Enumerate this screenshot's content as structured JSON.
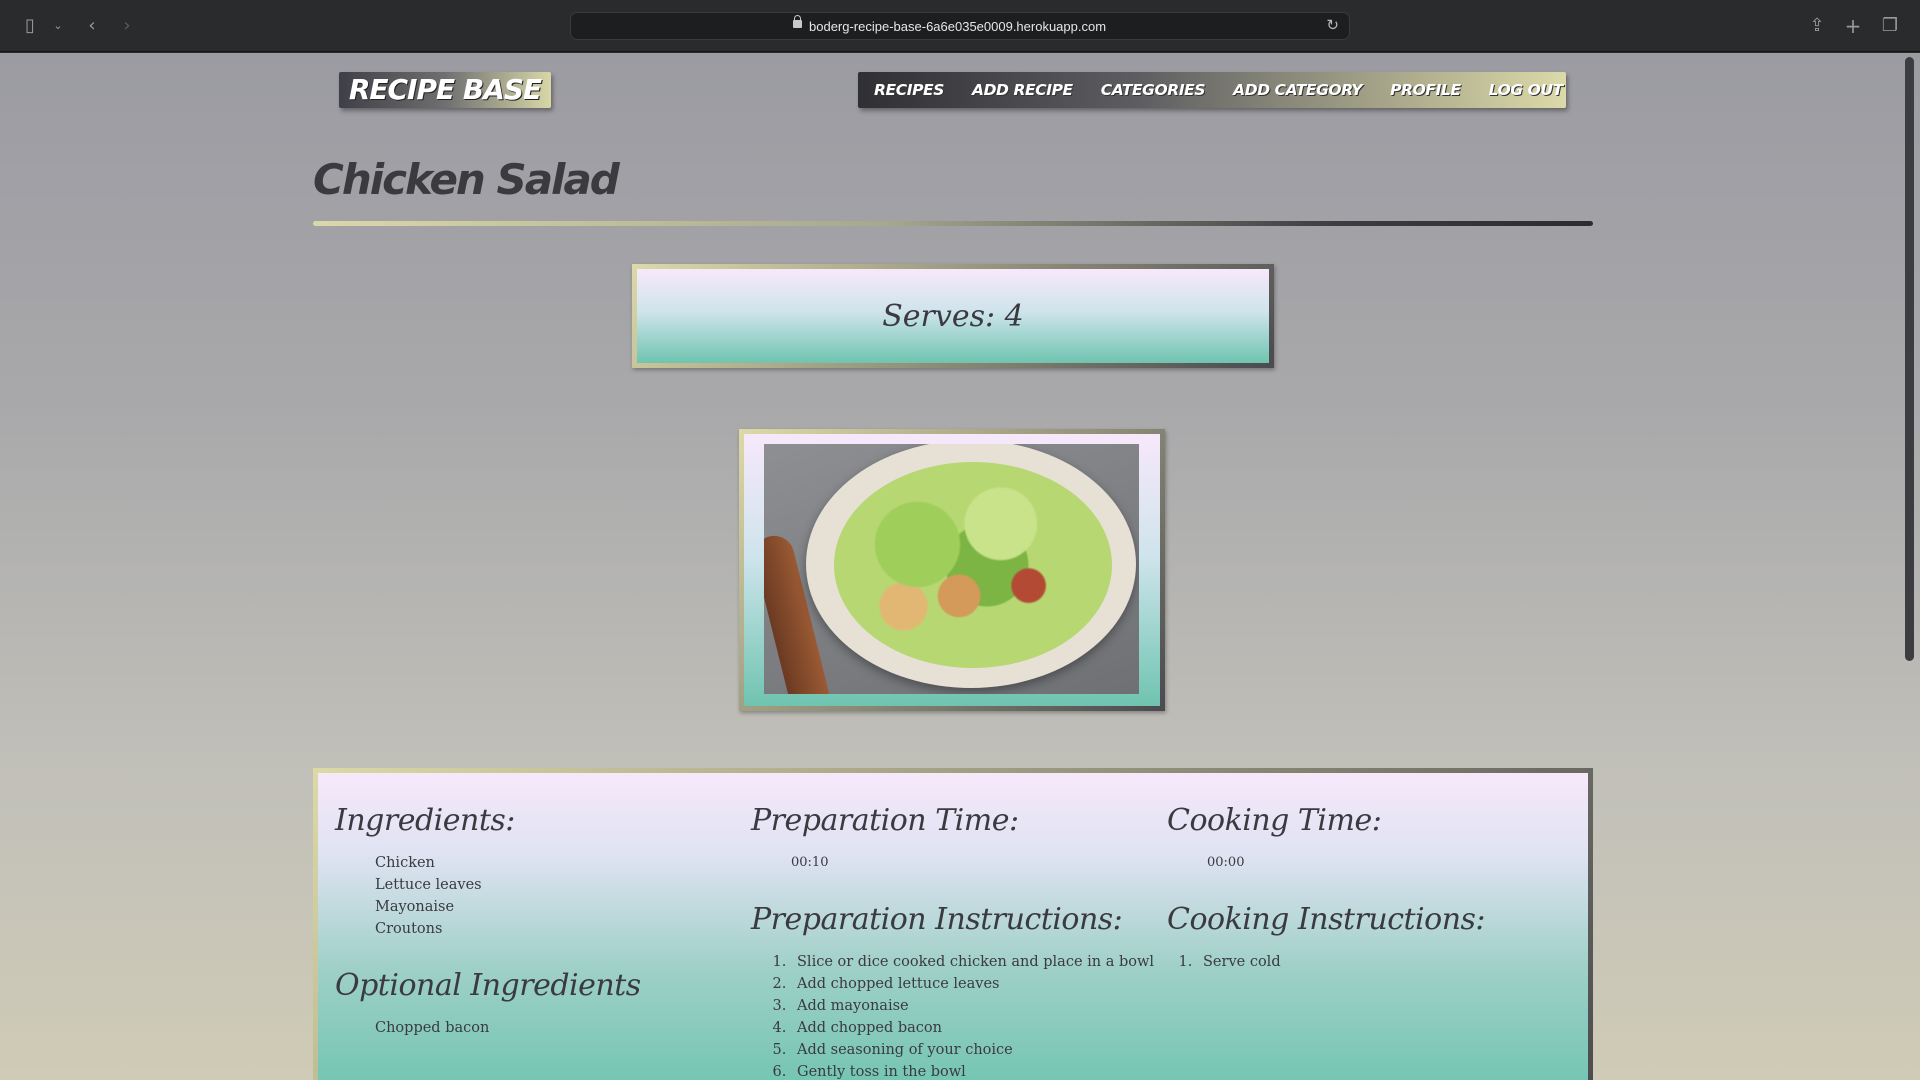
{
  "browser": {
    "url": "boderg-recipe-base-6a6e035e0009.herokuapp.com",
    "icons": {
      "sidebar": "sidebar-icon",
      "back": "back-arrow-icon",
      "forward": "forward-arrow-icon",
      "share": "share-icon",
      "new_tab": "plus-icon",
      "tabs": "tabs-overview-icon",
      "reload": "reload-icon",
      "lock": "lock-icon"
    }
  },
  "header": {
    "logo": "RECIPE BASE",
    "nav": [
      "RECIPES",
      "ADD RECIPE",
      "CATEGORIES",
      "ADD CATEGORY",
      "PROFILE",
      "LOG OUT"
    ]
  },
  "recipe": {
    "title": "Chicken Salad",
    "serves": "Serves: 4",
    "ingredients_heading": "Ingredients:",
    "ingredients": [
      "Chicken",
      "Lettuce leaves",
      "Mayonaise",
      "Croutons"
    ],
    "optional_heading": "Optional Ingredients",
    "optional": [
      "Chopped bacon"
    ],
    "prep_time_heading": "Preparation Time:",
    "prep_time": "00:10",
    "prep_instructions_heading": "Preparation Instructions:",
    "prep_instructions": [
      "Slice or dice cooked chicken and place in a bowl",
      "Add chopped lettuce leaves",
      "Add mayonaise",
      "Add chopped bacon",
      "Add seasoning of your choice",
      "Gently toss in the bowl"
    ],
    "cook_time_heading": "Cooking Time:",
    "cook_time": "00:00",
    "cook_instructions_heading": "Cooking Instructions:",
    "cook_instructions": [
      "Serve cold"
    ]
  }
}
